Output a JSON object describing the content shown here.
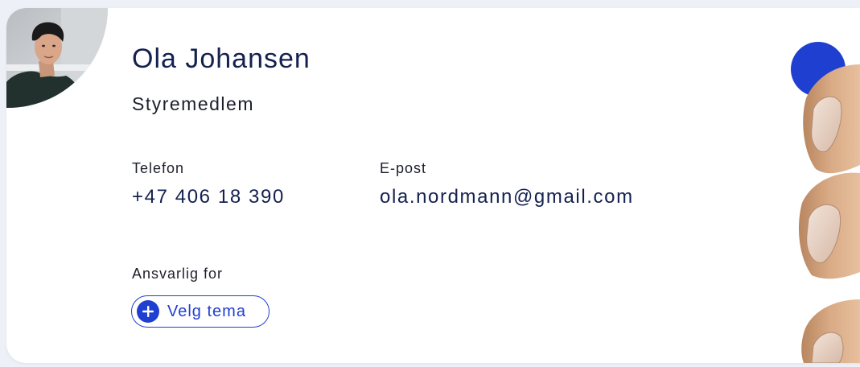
{
  "contact": {
    "name": "Ola Johansen",
    "role": "Styremedlem",
    "phone_label": "Telefon",
    "phone_value": "+47 406 18 390",
    "email_label": "E-post",
    "email_value": "ola.nordmann@gmail.com",
    "responsible_label": "Ansvarlig for",
    "choose_theme_label": "Velg tema"
  },
  "icons": {
    "avatar": "person-photo",
    "add": "plus-circle-icon"
  },
  "colors": {
    "primary": "#1f3fd1",
    "heading": "#14204f",
    "background": "#eef0f8",
    "card": "#ffffff"
  }
}
